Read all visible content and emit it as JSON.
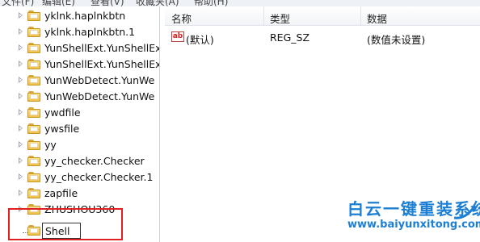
{
  "menubar": {
    "items": [
      "文件(F)",
      "编辑(E)",
      "查看(V)",
      "收藏夹(A)",
      "帮助(H)"
    ]
  },
  "tree": {
    "items": [
      {
        "label": "yklnk.haplnkbtn"
      },
      {
        "label": "yklnk.haplnkbtn.1"
      },
      {
        "label": "YunShellExt.YunShellEx"
      },
      {
        "label": "YunShellExt.YunShellEx"
      },
      {
        "label": "YunWebDetect.YunWe"
      },
      {
        "label": "YunWebDetect.YunWe"
      },
      {
        "label": "ywdfile"
      },
      {
        "label": "ywsfile"
      },
      {
        "label": "yy"
      },
      {
        "label": "yy_checker.Checker"
      },
      {
        "label": "yy_checker.Checker.1"
      },
      {
        "label": "zapfile"
      },
      {
        "label": "ZHUSHOU360"
      }
    ],
    "rename_value": "Shell"
  },
  "list": {
    "headers": {
      "name": "名称",
      "type": "类型",
      "data": "数据"
    },
    "rows": [
      {
        "icon": "string-value-icon",
        "icon_text": "ab",
        "name": "(默认)",
        "type": "REG_SZ",
        "data": "(数值未设置)"
      }
    ]
  },
  "watermark": {
    "title": "白云一键重装系统",
    "url": "www.baiyunxitong.com",
    "color": "#1c7fd4"
  },
  "colors": {
    "highlight_box": "#e02020",
    "folder": "#f0c04a"
  }
}
